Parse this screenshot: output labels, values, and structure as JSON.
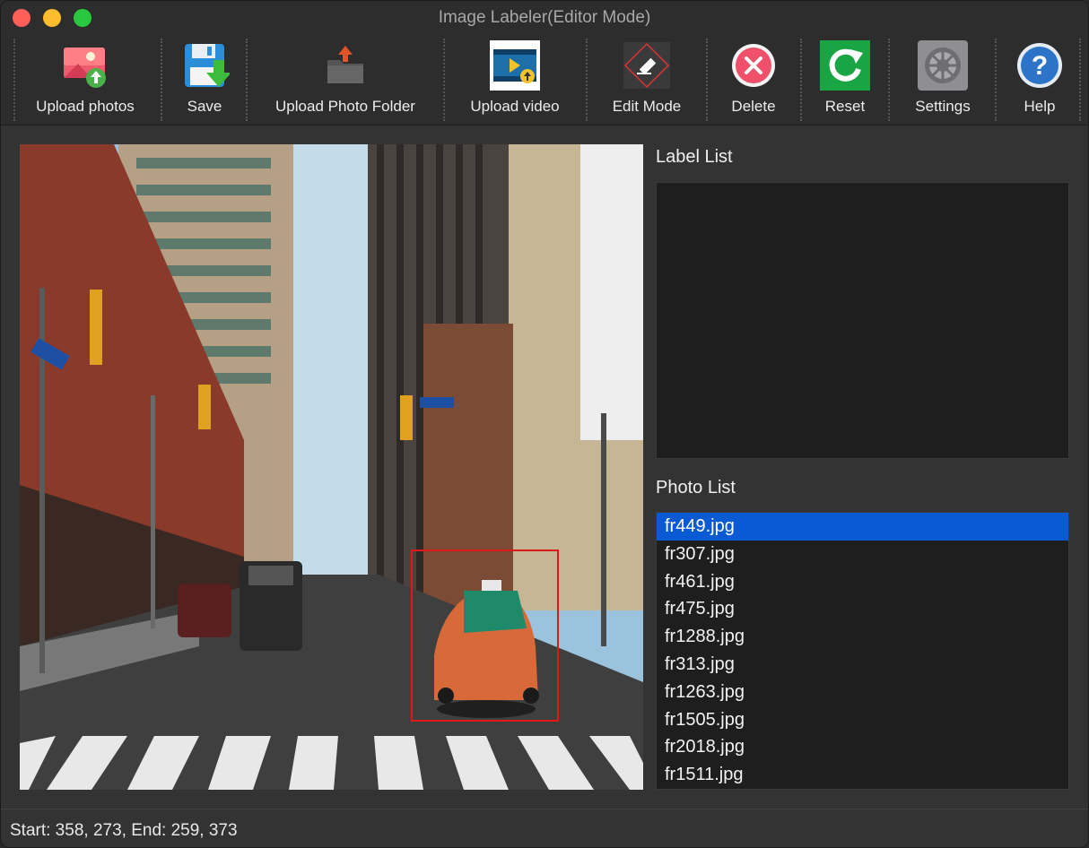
{
  "window": {
    "title": "Image Labeler(Editor Mode)"
  },
  "toolbar": {
    "upload_photos": "Upload photos",
    "save": "Save",
    "upload_folder": "Upload Photo Folder",
    "upload_video": "Upload video",
    "edit_mode": "Edit Mode",
    "delete": "Delete",
    "reset": "Reset",
    "settings": "Settings",
    "help": "Help"
  },
  "colors": {
    "selection": "#0a5bd3",
    "bounding_box": "#e01818",
    "window_bg": "#333333",
    "list_bg": "#1e1e1e"
  },
  "sidebar": {
    "label_list_title": "Label List",
    "labels": [],
    "photo_list_title": "Photo List",
    "photos": [
      "fr449.jpg",
      "fr307.jpg",
      "fr461.jpg",
      "fr475.jpg",
      "fr1288.jpg",
      "fr313.jpg",
      "fr1263.jpg",
      "fr1505.jpg",
      "fr2018.jpg",
      "fr1511.jpg"
    ],
    "selected_index": 0
  },
  "status": {
    "text": "Start: 358, 273, End: 259, 373"
  }
}
